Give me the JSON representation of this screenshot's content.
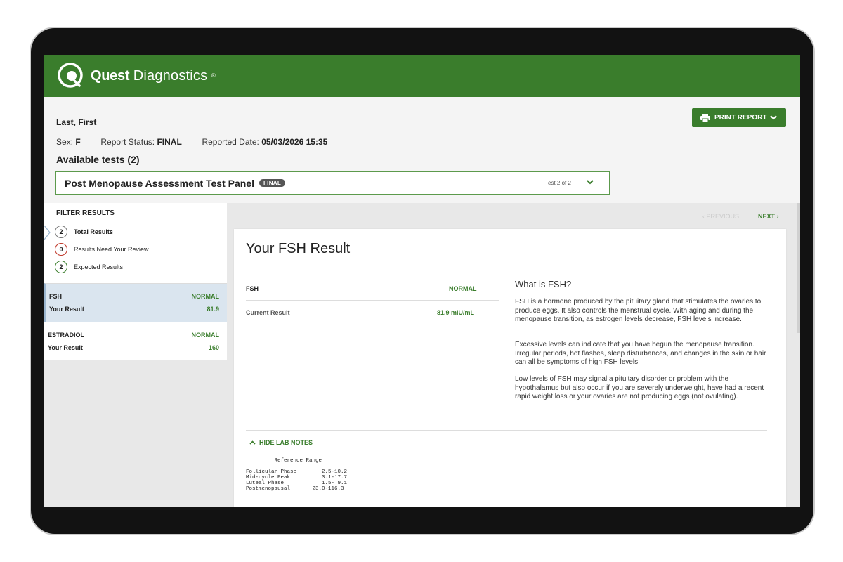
{
  "brand": {
    "quest": "Quest",
    "diagnostics": "Diagnostics",
    "reg_mark": "®",
    "color": "#3a7d2c"
  },
  "header": {
    "patient_name": "Last, First",
    "sex_label": "Sex:",
    "sex_value": "F",
    "status_label": "Report Status:",
    "status_value": "FINAL",
    "date_label": "Reported Date:",
    "date_value": "05/03/2026 15:35",
    "available_tests": "Available tests (2)",
    "print_button": "PRINT REPORT"
  },
  "panel": {
    "name": "Post Menopause Assessment Test Panel",
    "badge": "FINAL",
    "test_count": "Test 2 of 2"
  },
  "filter": {
    "title": "FILTER RESULTS",
    "items": [
      {
        "count": "2",
        "label": "Total Results"
      },
      {
        "count": "0",
        "label": "Results Need Your Review"
      },
      {
        "count": "2",
        "label": "Expected Results"
      }
    ]
  },
  "results": [
    {
      "name": "FSH",
      "status": "NORMAL",
      "label": "Your Result",
      "value": "81.9"
    },
    {
      "name": "ESTRADIOL",
      "status": "NORMAL",
      "label": "Your Result",
      "value": "160"
    }
  ],
  "pager": {
    "previous": "PREVIOUS",
    "next": "NEXT"
  },
  "detail": {
    "title": "Your FSH Result",
    "test_name": "FSH",
    "status": "NORMAL",
    "current_label": "Current Result",
    "current_value": "81.9 mIU/mL",
    "info_title": "What is FSH?",
    "info_paragraphs": [
      "FSH is a hormone produced by the pituitary gland that stimulates the ovaries to produce eggs. It also controls the menstrual cycle. With aging and during the menopause transition, as estrogen levels decrease, FSH levels increase.",
      "Excessive levels can indicate that you have begun the menopause transition. Irregular periods, hot flashes, sleep disturbances, and changes in the skin or hair can all be symptoms of high FSH levels.",
      "Low levels of FSH may signal a pituitary disorder or problem with the hypothalamus but also occur if you are severely underweight, have had a recent rapid weight loss or your ovaries are not producing eggs (not ovulating)."
    ],
    "hide_notes": "HIDE LAB NOTES",
    "lab_notes": "         Reference Range\n\nFollicular Phase        2.5-10.2\nMid-cycle Peak          3.1-17.7\nLuteal Phase            1.5- 9.1\nPostmenopausal       23.0-116.3"
  }
}
